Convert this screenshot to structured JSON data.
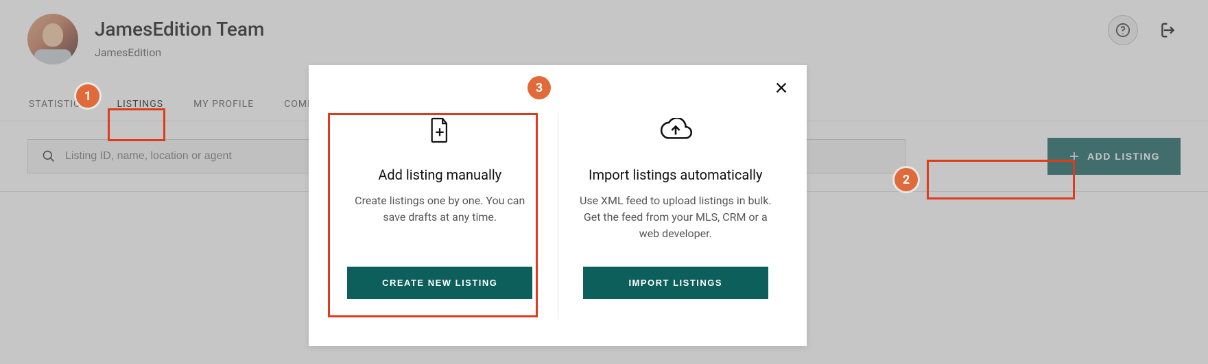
{
  "profile": {
    "name": "JamesEdition Team",
    "subtitle": "JamesEdition"
  },
  "tabs": {
    "statistics": "STATISTICS",
    "listings": "LISTINGS",
    "my_profile": "MY PROFILE",
    "company": "COMPA"
  },
  "search": {
    "placeholder": "Listing ID, name, location or agent"
  },
  "add_listing_label": "ADD LISTING",
  "modal": {
    "manual": {
      "title": "Add listing manually",
      "desc": "Create listings one by one. You can save drafts at any time.",
      "button": "CREATE NEW LISTING"
    },
    "auto": {
      "title": "Import listings automatically",
      "desc": "Use XML feed to upload listings in bulk. Get the feed from your MLS, CRM or a web developer.",
      "button": "IMPORT LISTINGS"
    }
  },
  "badges": {
    "b1": "1",
    "b2": "2",
    "b3": "3"
  }
}
